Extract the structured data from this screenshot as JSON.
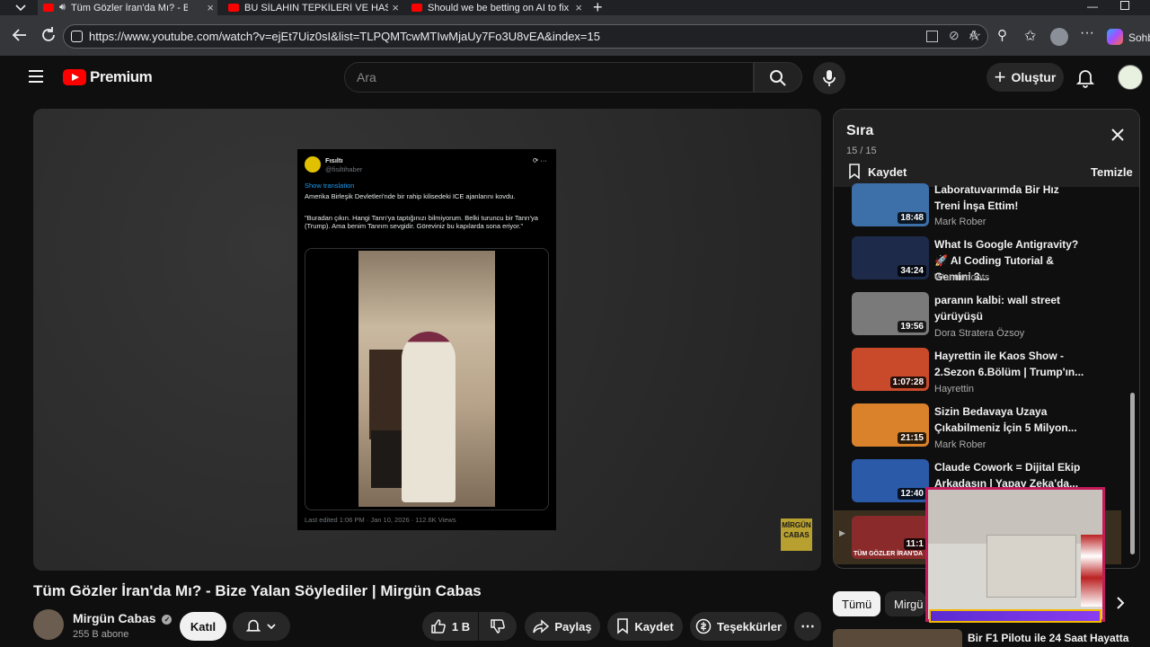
{
  "browser": {
    "tabs": [
      {
        "title": "Tüm Gözler İran'da Mı? - Bize Yalan Söylediler"
      },
      {
        "title": "BU SİLAHIN TEPKİLERİ VE HASARI"
      },
      {
        "title": "Should we be betting on AI to fix"
      }
    ],
    "url": "https://www.youtube.com/watch?v=ejEt7Uiz0sI&list=TLPQMTcwMTIwMjaUy7Fo3U8vEA&index=15",
    "copilot_label": "Sohb"
  },
  "youtube": {
    "logo_text": "Premium",
    "search_placeholder": "Ara",
    "create_label": "Oluştur"
  },
  "tweet": {
    "account_name": "Fısıltı",
    "account_handle": "@fisiltihaber",
    "show_translation": "Show translation",
    "line1": "Amerika Birleşik Devletleri'nde bir rahip kilisedeki ICE ajanlarını kovdu.",
    "line2": "\"Buradan çıkın. Hangi Tanrı'ya taptığınızı bilmiyorum. Belki turuncu bir Tanrı'ya (Trump). Ama benim Tanrım sevgidir. Göreviniz bu kapılarda sona eriyor.\"",
    "footer": "Last edited 1:06 PM · Jan 10, 2026 · 112.6K Views"
  },
  "watermark": "MİRGÜN CABAS",
  "video": {
    "title": "Tüm Gözler İran'da Mı? - Bize Yalan Söylediler | Mirgün Cabas",
    "channel": "Mirgün Cabas",
    "subscribers": "255 B abone",
    "join_label": "Katıl",
    "like_count": "1 B",
    "share_label": "Paylaş",
    "save_label": "Kaydet",
    "thanks_label": "Teşekkürler"
  },
  "queue": {
    "title": "Sıra",
    "position": "15 / 15",
    "save_label": "Kaydet",
    "clear_label": "Temizle",
    "items": [
      {
        "title": "Laboratuvarımda Bir Hız Treni İnşa Ettim!",
        "channel": "Mark Rober",
        "duration": "18:48",
        "thumb_color": "#3d6fa8"
      },
      {
        "title": "What Is Google Antigravity? 🚀 AI Coding Tutorial & Gemini 3...",
        "channel": "Wanderloots",
        "duration": "34:24",
        "thumb_color": "#1d2a4a"
      },
      {
        "title": "paranın kalbi: wall street yürüyüşü",
        "channel": "Dora Stratera Özsoy",
        "duration": "19:56",
        "thumb_color": "#7a7a7a"
      },
      {
        "title": "Hayrettin ile Kaos Show - 2.Sezon 6.Bölüm | Trump'ın...",
        "channel": "Hayrettin",
        "duration": "1:07:28",
        "thumb_color": "#c84a2a"
      },
      {
        "title": "Sizin Bedavaya Uzaya Çıkabilmeniz İçin 5 Milyon...",
        "channel": "Mark Rober",
        "duration": "21:15",
        "thumb_color": "#d9822b"
      },
      {
        "title": "Claude Cowork = Dijital Ekip Arkadaşın | Yapay Zeka'da...",
        "channel": "",
        "duration": "12:40",
        "thumb_color": "#2b5aa8"
      },
      {
        "title": "",
        "channel": "",
        "duration": "11:1",
        "thumb_color": "#8a2a2a",
        "thumb_caption": "TÜM GÖZLER İRAN'DA"
      }
    ]
  },
  "chips": [
    {
      "label": "Tümü"
    },
    {
      "label": "Mirgü"
    }
  ],
  "next_item": {
    "title": "Bir F1 Pilotu ile 24 Saat Hayatta"
  }
}
